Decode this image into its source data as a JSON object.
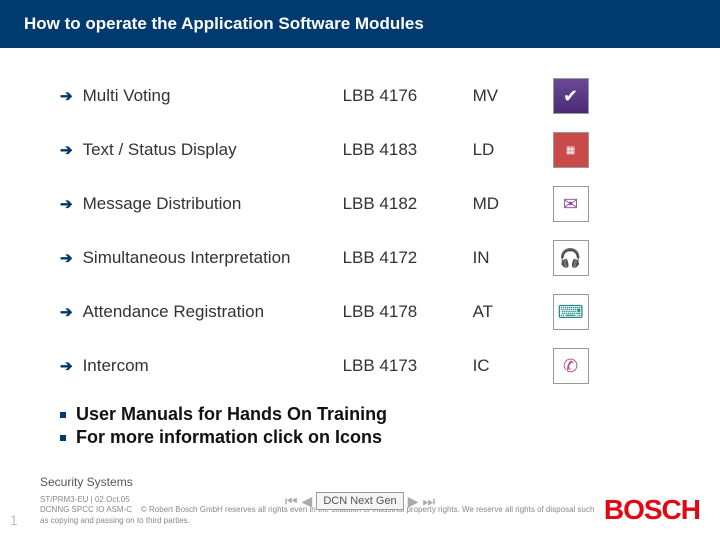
{
  "header": {
    "title": "How to operate the Application Software Modules"
  },
  "modules": [
    {
      "name": "Multi Voting",
      "code": "LBB 4176",
      "abbr": "MV",
      "icon": "mv"
    },
    {
      "name": "Text / Status Display",
      "code": "LBB 4183",
      "abbr": "LD",
      "icon": "ld"
    },
    {
      "name": "Message Distribution",
      "code": "LBB 4182",
      "abbr": "MD",
      "icon": "md"
    },
    {
      "name": "Simultaneous Interpretation",
      "code": "LBB 4172",
      "abbr": "IN",
      "icon": "in"
    },
    {
      "name": "Attendance Registration",
      "code": "LBB 4178",
      "abbr": "AT",
      "icon": "at"
    },
    {
      "name": "Intercom",
      "code": "LBB 4173",
      "abbr": "IC",
      "icon": "ic"
    }
  ],
  "notes": [
    "User Manuals for Hands On Training",
    "For more information click on Icons"
  ],
  "footer": {
    "dept": "Security Systems",
    "line1": "ST/PRM3-EU | 02.Oct.05",
    "line2": "DCNNG SPCC IO ASM-C",
    "copyright": "© Robert Bosch GmbH reserves all rights even in the situation of industrial property rights. We reserve all rights of disposal such as copying and passing on to third parties.",
    "nav_label": "DCN Next Gen",
    "logo": "BOSCH",
    "page": "1"
  },
  "icon_glyphs": {
    "mv": "✔",
    "ld": "▦",
    "md": "✉",
    "in": "🎧",
    "at": "⌨",
    "ic": "✆"
  }
}
